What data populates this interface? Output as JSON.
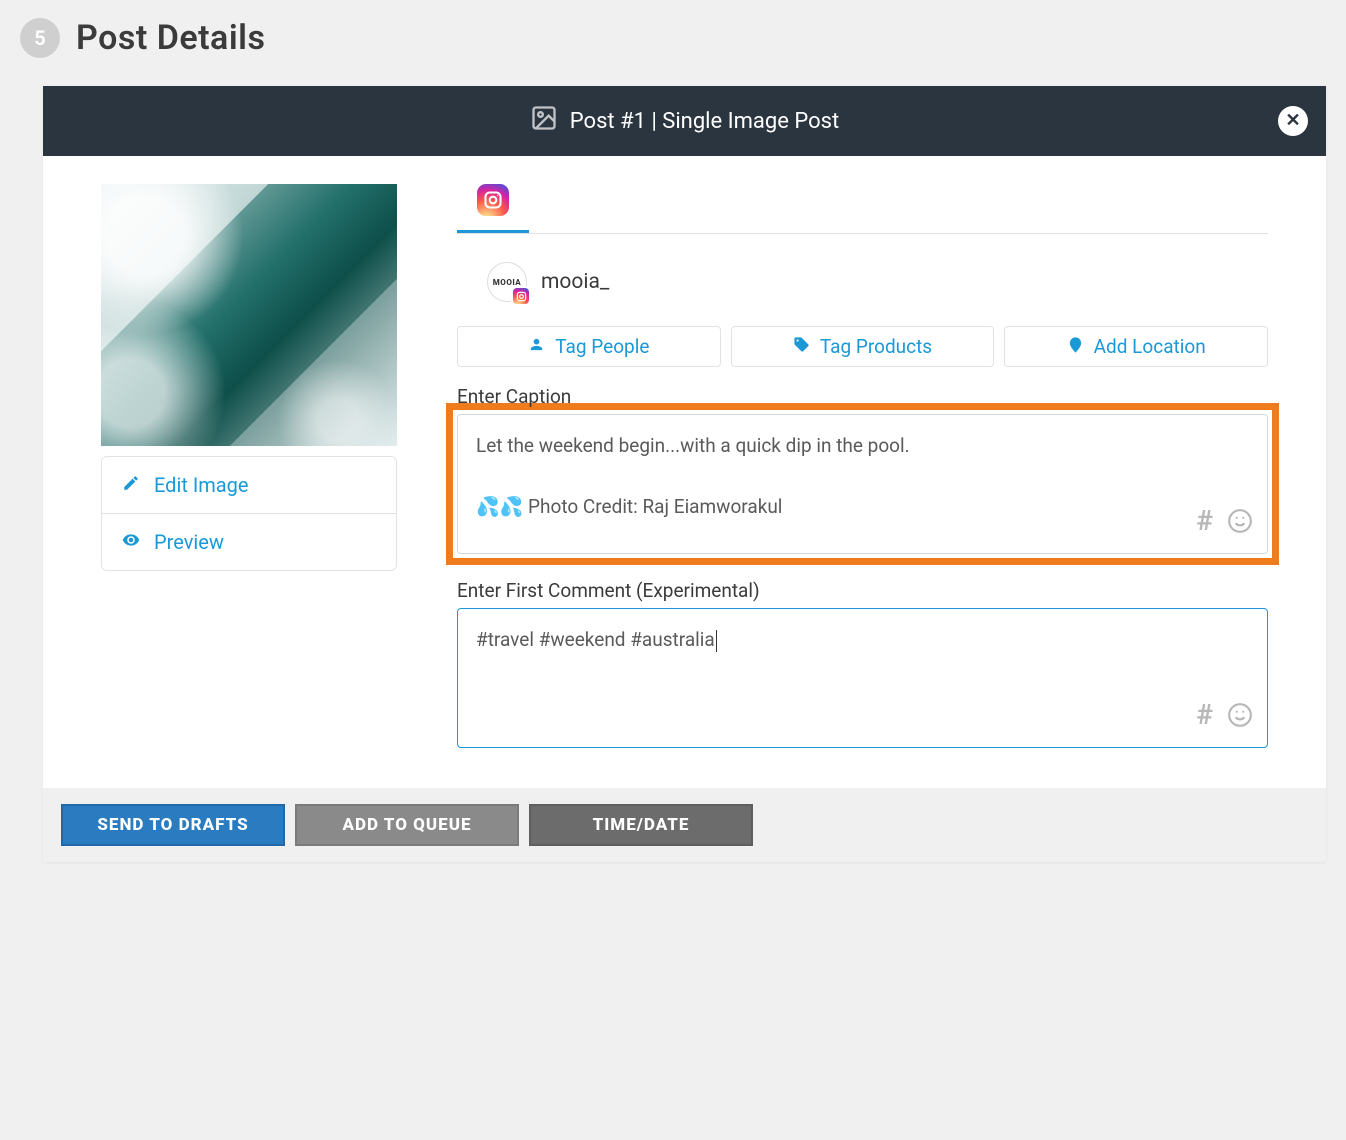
{
  "step_number": "5",
  "section_title": "Post Details",
  "header": {
    "title": "Post #1 | Single Image Post"
  },
  "image_actions": {
    "edit": "Edit Image",
    "preview": "Preview"
  },
  "account": {
    "name": "mooia_",
    "avatar_text": "MOOIA"
  },
  "tag_buttons": {
    "people": "Tag People",
    "products": "Tag Products",
    "location": "Add Location"
  },
  "caption": {
    "label": "Enter Caption",
    "line1": "Let the weekend begin...with a quick dip in the pool.",
    "line2": "💦💦 Photo Credit: Raj Eiamworakul"
  },
  "first_comment": {
    "label": "Enter First Comment (Experimental)",
    "value": "#travel #weekend #australia"
  },
  "footer": {
    "drafts": "SEND TO DRAFTS",
    "queue": "ADD TO QUEUE",
    "timedate": "TIME/DATE"
  }
}
